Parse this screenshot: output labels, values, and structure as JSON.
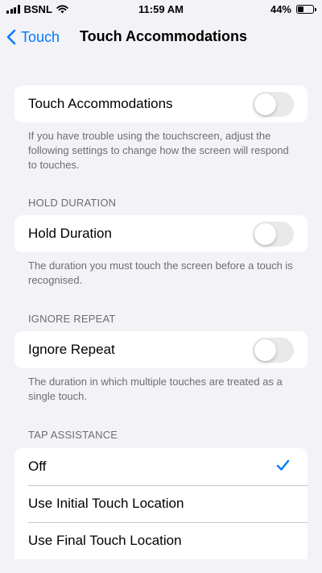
{
  "status": {
    "carrier": "BSNL",
    "time": "11:59 AM",
    "battery_percent": "44%",
    "battery_level": 0.44
  },
  "nav": {
    "back_label": "Touch",
    "title": "Touch Accommodations"
  },
  "touch_accommodations": {
    "label": "Touch Accommodations",
    "enabled": false,
    "footer": "If you have trouble using the touchscreen, adjust the following settings to change how the screen will respond to touches."
  },
  "hold_duration": {
    "header": "HOLD DURATION",
    "label": "Hold Duration",
    "enabled": false,
    "footer": "The duration you must touch the screen before a touch is recognised."
  },
  "ignore_repeat": {
    "header": "IGNORE REPEAT",
    "label": "Ignore Repeat",
    "enabled": false,
    "footer": "The duration in which multiple touches are treated as a single touch."
  },
  "tap_assistance": {
    "header": "TAP ASSISTANCE",
    "options": [
      {
        "label": "Off",
        "selected": true
      },
      {
        "label": "Use Initial Touch Location",
        "selected": false
      },
      {
        "label": "Use Final Touch Location",
        "selected": false
      }
    ]
  },
  "colors": {
    "accent": "#007aff",
    "background": "#f2f2f7",
    "toggle_off": "#e9e9eb",
    "secondary_text": "#6d6d72"
  }
}
